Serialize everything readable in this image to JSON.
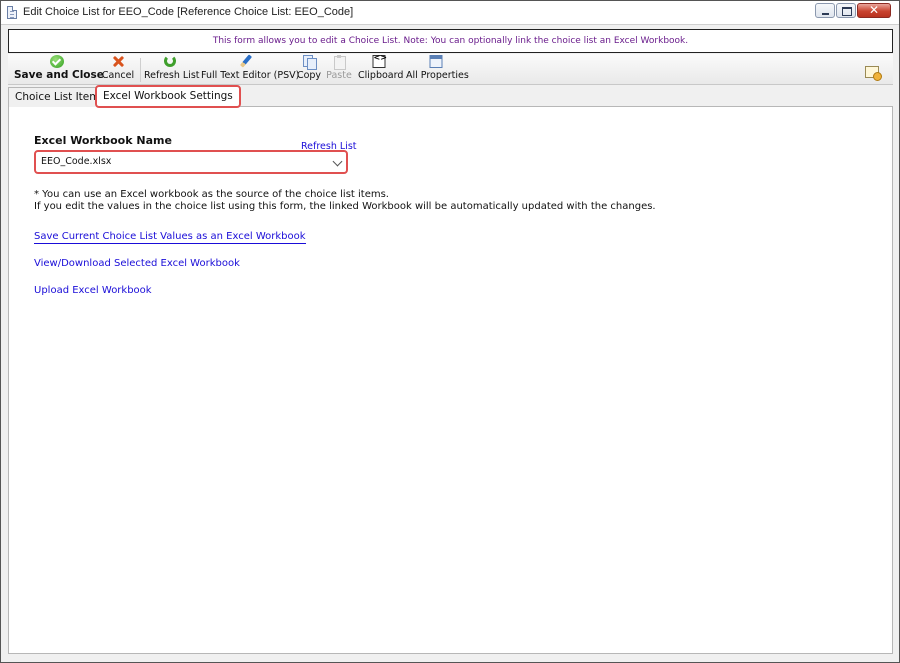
{
  "window": {
    "title": "Edit Choice List for EEO_Code [Reference Choice List: EEO_Code]",
    "close_glyph": "✕"
  },
  "banner": {
    "message": "This form allows you to edit a Choice List.  Note: You can optionally link the choice list an Excel Workbook."
  },
  "toolbar": {
    "save_close": "Save and Close",
    "cancel": "Cancel",
    "refresh_list": "Refresh List",
    "full_text_editor": "Full Text Editor (PSV)",
    "copy": "Copy",
    "paste": "Paste",
    "clipboard": "Clipboard",
    "clipboard_glyph": "<>",
    "all_properties": "All Properties"
  },
  "tabs": [
    {
      "label": "Choice List Items",
      "active": false
    },
    {
      "label": "Excel Workbook Settings",
      "active": true
    }
  ],
  "form": {
    "workbook_label": "Excel Workbook Name",
    "refresh_link": "Refresh List",
    "workbook_value": "EEO_Code.xlsx",
    "note_line1": "* You can use an Excel workbook as the source of the choice list items.",
    "note_line2": "If you edit the values in the choice list using this form, the linked Workbook will be automatically updated with the changes."
  },
  "links": {
    "save_as_workbook": "Save Current Choice List Values as an Excel Workbook",
    "view_download": "View/Download Selected Excel Workbook",
    "upload": "Upload Excel Workbook"
  },
  "colors": {
    "highlight_border": "#e05050",
    "link": "#1a0dd8",
    "banner_text": "#6a1d8c"
  }
}
